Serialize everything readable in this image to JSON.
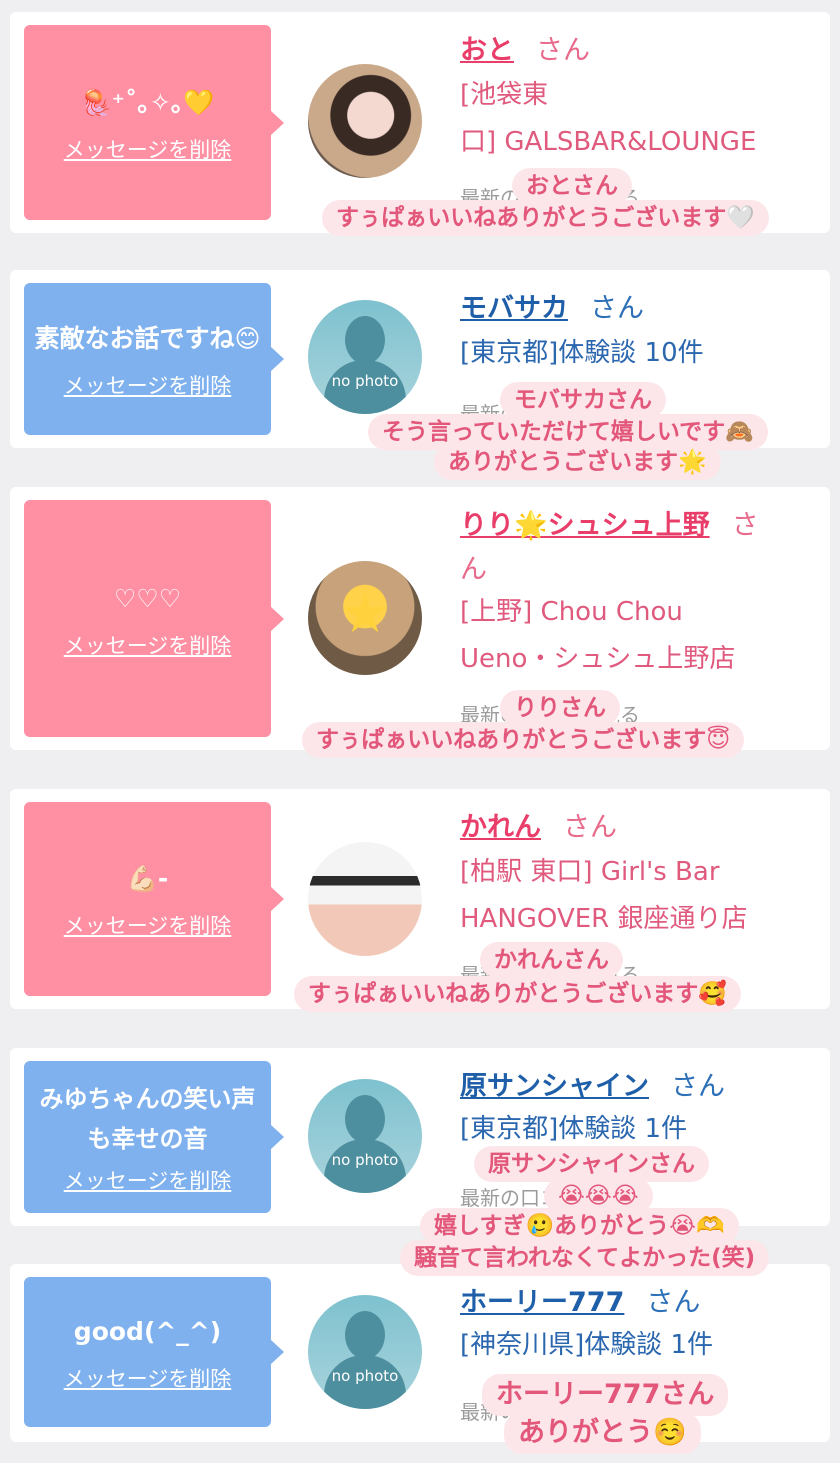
{
  "delete_label": "メッセージを削除",
  "last_label": "最新の口コミを見る",
  "nophoto_label": "no photo",
  "cards": [
    {
      "bubble_text": "🪼⁺˚｡✧｡💛",
      "name": "おと",
      "san": "さん",
      "shop_line1": "[池袋東",
      "shop_line2": "口] GALSBAR&LOUNGE"
    },
    {
      "bubble_text": "素敵なお話ですね😊",
      "name": "モバサカ",
      "san": "さん",
      "shop_line1": "[東京都]体験談 10件"
    },
    {
      "bubble_text": "♡♡♡",
      "name": "りり🌟シュシュ上野",
      "san": "さ",
      "name_wrap": "ん",
      "shop_line1": "[上野] Chou Chou",
      "shop_line2": "Ueno・シュシュ上野店"
    },
    {
      "bubble_text": "💪🏻-",
      "name": "かれん",
      "san": "さん",
      "shop_line1": "[柏駅 東口] Girl's Bar",
      "shop_line2": "HANGOVER 銀座通り店"
    },
    {
      "bubble_text": "みゆちゃんの笑い声も幸せの音",
      "name": "原サンシャイン",
      "san": "さん",
      "shop_line1": "[東京都]体験談 1件"
    },
    {
      "bubble_text": "good(^_^)",
      "name": "ホーリー777",
      "san": "さん",
      "shop_line1": "[神奈川県]体験談 1件"
    }
  ],
  "overlays": {
    "o1a": "おとさん",
    "o1b": "すぅぱぁいいねありがとうございます🤍",
    "o2a": "モバサカさん",
    "o2b": "そう言っていただけて嬉しいです🙈",
    "o2c": "ありがとうございます🌟",
    "o3a": "りりさん",
    "o3b": "すぅぱぁいいねありがとうございます😇",
    "o4a": "かれんさん",
    "o4b": "すぅぱぁいいねありがとうございます🥰",
    "o5a": "原サンシャインさん",
    "o5b": "😭😭😭",
    "o5c": "嬉しすぎ🥲ありがとう😭🫶",
    "o5d": "騒音て言われなくてよかった(笑)",
    "o6a": "ホーリー777さん",
    "o6b": "ありがとう☺️"
  }
}
